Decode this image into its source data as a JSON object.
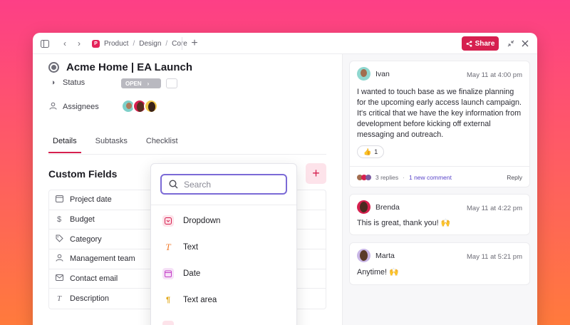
{
  "colors": {
    "accent": "#d6204f",
    "focus": "#7b6ad6",
    "link": "#5b46c9"
  },
  "breadcrumb": {
    "badge": "P",
    "items": [
      "Product",
      "Design",
      "Core"
    ]
  },
  "share": {
    "label": "Share",
    "icon": "share-icon"
  },
  "task": {
    "title": "Acme Home | EA Launch",
    "status_label": "Status",
    "status_value": "OPEN",
    "assignees_label": "Assignees"
  },
  "tabs": [
    "Details",
    "Subtasks",
    "Checklist"
  ],
  "custom_fields": {
    "title": "Custom Fields",
    "rows": [
      {
        "label": "Project date",
        "icon": "calendar-icon"
      },
      {
        "label": "Budget",
        "icon": "dollar-icon"
      },
      {
        "label": "Category",
        "icon": "tag-icon"
      },
      {
        "label": "Management team",
        "icon": "person-icon"
      },
      {
        "label": "Contact email",
        "icon": "mail-icon"
      },
      {
        "label": "Description",
        "icon": "text-icon"
      }
    ]
  },
  "popup": {
    "search_placeholder": "Search",
    "options": [
      {
        "label": "Dropdown",
        "icon": "dropdown-icon"
      },
      {
        "label": "Text",
        "icon": "text-t-icon"
      },
      {
        "label": "Date",
        "icon": "calendar-icon"
      },
      {
        "label": "Text area",
        "icon": "text-area-icon"
      }
    ]
  },
  "comments": [
    {
      "author": "Ivan",
      "time": "May 11 at 4:00 pm",
      "text": "I wanted to touch base as we finalize planning for the upcoming early access launch campaign. It's critical that we have the key information from development before kicking off external messaging and outreach.",
      "reaction_emoji": "👍",
      "reaction_count": "1",
      "replies": "3 replies",
      "new_comment": "1 new comment",
      "reply_label": "Reply"
    },
    {
      "author": "Brenda",
      "time": "May 11 at 4:22 pm",
      "text": "This is great, thank you! 🙌"
    },
    {
      "author": "Marta",
      "time": "May 11 at 5:21 pm",
      "text": "Anytime! 🙌"
    }
  ]
}
